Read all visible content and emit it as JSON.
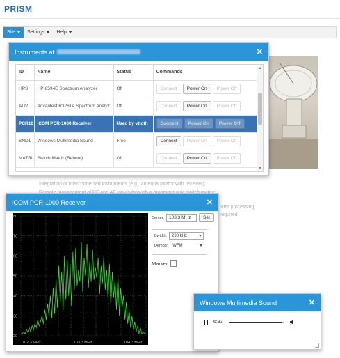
{
  "app": {
    "brand": "PRISM"
  },
  "menu": [
    {
      "label": "Site",
      "active": true
    },
    {
      "label": "Settings",
      "active": false
    },
    {
      "label": "Help",
      "active": false
    }
  ],
  "background_text": [
    "Integration of interconnected instruments (e.g., antenna rotator with receiver);",
    "Remote management of RF and AF inputs through a programmable switch matrix;",
    "later processing,",
    "required;"
  ],
  "instruments_dialog": {
    "title": "Instruments at",
    "columns": [
      "ID",
      "Name",
      "Status",
      "Commands"
    ],
    "rows": [
      {
        "id": "HPS",
        "name": "HP-8594E Spectrum Analyzer",
        "status": "Off",
        "connect": "Connect",
        "power_on": "Power On",
        "power_off": "Power Off",
        "selected": false
      },
      {
        "id": "ADV",
        "name": "Advantest R3261A Spectrum Analyz",
        "status": "Off",
        "connect": "Connect",
        "power_on": "Power On",
        "power_off": "Power Off",
        "selected": false
      },
      {
        "id": "PCR10",
        "name": "ICOM PCR-1000 Receiver",
        "status": "Used by vttoth",
        "connect": "Connect",
        "power_on": "Power On",
        "power_off": "Power Off",
        "selected": true
      },
      {
        "id": "SND1",
        "name": "Windows Multimedia Sound",
        "status": "Free",
        "connect": "Connect",
        "power_on": "Power On",
        "power_off": "Power Off",
        "selected": false
      },
      {
        "id": "MATRI",
        "name": "Switch Matrix (Reboot)",
        "status": "Off",
        "connect": "Connect",
        "power_on": "Power On",
        "power_off": "Power Off",
        "selected": false
      }
    ]
  },
  "receiver_dialog": {
    "title": "ICOM PCR-1000 Receiver",
    "center_label": "Center:",
    "center_value": "103.3 MHz",
    "set_label": "Set",
    "bandwidth_label": "Bwidth:",
    "bandwidth_value": "230 kHz",
    "demod_label": "Demod:",
    "demod_value": "WFM",
    "marker_label": "Marker"
  },
  "chart_data": {
    "type": "line",
    "yticks": [
      "80",
      "70",
      "60",
      "50",
      "40",
      "30",
      "20"
    ],
    "xticks": [
      "102.3 MHz",
      "103.3 MHz",
      "104.3 MHz"
    ],
    "ylim": [
      20,
      80
    ],
    "series": [
      {
        "color": "#33dd33",
        "values": [
          21,
          21,
          22,
          21,
          23,
          22,
          24,
          22,
          25,
          23,
          26,
          24,
          28,
          25,
          27,
          30,
          26,
          33,
          28,
          36,
          30,
          40,
          29,
          44,
          31,
          48,
          34,
          55,
          37,
          52,
          33,
          60,
          38,
          58,
          40,
          56,
          35,
          62,
          43,
          64,
          45,
          53,
          47,
          67,
          42,
          59,
          50,
          66,
          44,
          57,
          47,
          63,
          48,
          54,
          49,
          59,
          41,
          55,
          46,
          60,
          43,
          53,
          38,
          56,
          35,
          52,
          39,
          48,
          33,
          50,
          30,
          44,
          34,
          40,
          28,
          37,
          26,
          33,
          24,
          30,
          23,
          27,
          22,
          25,
          21,
          24,
          21,
          22,
          21,
          21
        ]
      }
    ]
  },
  "sound_dialog": {
    "title": "Windows Multimedia Sound",
    "time": "6:33",
    "progress": 0.95
  },
  "colors": {
    "accent": "#2b95d9",
    "selected_row": "#3a73b3",
    "plot_bg": "#000000",
    "plot_line": "#33dd33"
  }
}
